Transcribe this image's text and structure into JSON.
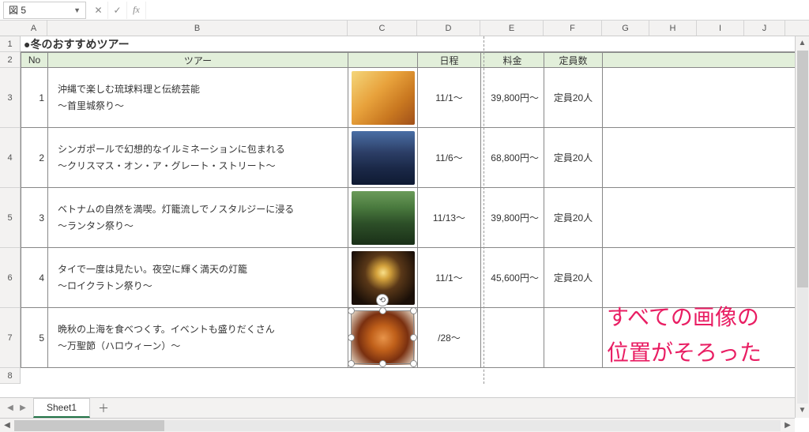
{
  "name_box": "図 5",
  "fx_label": "fx",
  "columns": [
    "A",
    "B",
    "C",
    "D",
    "E",
    "F",
    "G",
    "H",
    "I",
    "J"
  ],
  "row_numbers": [
    "1",
    "2",
    "3",
    "4",
    "5",
    "6",
    "7",
    "8"
  ],
  "title": "●冬のおすすめツアー",
  "headers": {
    "no": "No",
    "tour": "ツアー",
    "image": "",
    "schedule": "日程",
    "price": "料金",
    "capacity": "定員数"
  },
  "tours": [
    {
      "no": "1",
      "line1": "沖縄で楽しむ琉球料理と伝統芸能",
      "line2": "～首里城祭り～",
      "schedule": "11/1～",
      "price": "39,800円～",
      "capacity": "定員20人",
      "thumb": "thumb-1"
    },
    {
      "no": "2",
      "line1": "シンガポールで幻想的なイルミネーションに包まれる",
      "line2": "～クリスマス・オン・ア・グレート・ストリート～",
      "schedule": "11/6～",
      "price": "68,800円～",
      "capacity": "定員20人",
      "thumb": "thumb-2"
    },
    {
      "no": "3",
      "line1": "ベトナムの自然を満喫。灯籠流しでノスタルジーに浸る",
      "line2": "～ランタン祭り～",
      "schedule": "11/13～",
      "price": "39,800円～",
      "capacity": "定員20人",
      "thumb": "thumb-3"
    },
    {
      "no": "4",
      "line1": "タイで一度は見たい。夜空に輝く満天の灯籠",
      "line2": "～ロイクラトン祭り～",
      "schedule": "11/1～",
      "price": "45,600円～",
      "capacity": "定員20人",
      "thumb": "thumb-4"
    },
    {
      "no": "5",
      "line1": "晩秋の上海を食べつくす。イベントも盛りだくさん",
      "line2": "～万聖節（ハロウィーン）～",
      "schedule": "/28～",
      "price": "",
      "capacity": "",
      "thumb": "thumb-5",
      "selected": true
    }
  ],
  "annotation": {
    "line1": "すべての画像の",
    "line2": "位置がそろった"
  },
  "sheet_tab": "Sheet1",
  "add_sheet": "＋"
}
